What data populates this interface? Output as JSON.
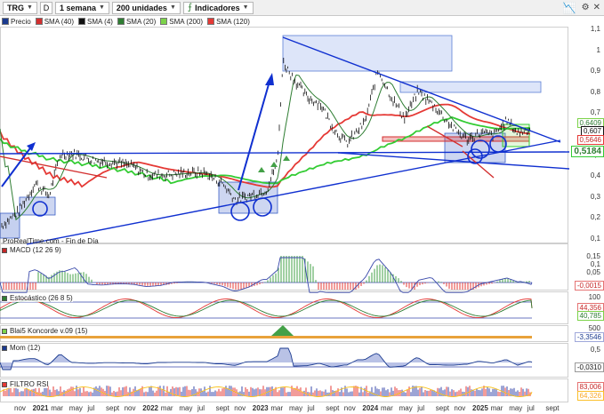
{
  "toolbar": {
    "symbol": "TRG",
    "letter": "D",
    "period": "1 semana",
    "units": "200 unidades",
    "indicators": "Indicadores"
  },
  "legend": [
    {
      "label": "Precio",
      "color": "#1a3a8f"
    },
    {
      "label": "SMA (40)",
      "color": "#d32f2f"
    },
    {
      "label": "SMA (4)",
      "color": "#111111"
    },
    {
      "label": "SMA (20)",
      "color": "#2e7d32"
    },
    {
      "label": "SMA (200)",
      "color": "#7cd34a"
    },
    {
      "label": "SMA (120)",
      "color": "#e53935"
    }
  ],
  "price_axis": [
    "1,1",
    "1",
    "0,9",
    "0,8",
    "0,7",
    "0,6",
    "0,5",
    "0,4",
    "0,3",
    "0,2",
    "0,1"
  ],
  "badges": {
    "a": "0,6409",
    "b": "0,607",
    "c": "0,5646",
    "d": "0,5184"
  },
  "source_label": "ProRealTime.com - Fin de Día",
  "panels": {
    "macd": {
      "title": "MACD (12 26 9)",
      "axis": [
        "0,15",
        "0,1",
        "0,05"
      ],
      "value": "-0,0015"
    },
    "stoch": {
      "title": "Estocástico (26 8 5)",
      "axis": [
        "100"
      ],
      "v1": "44,356",
      "v2": "40,785"
    },
    "blai": {
      "title": "Blai5 Koncorde v.09 (15)",
      "axis": [
        "500",
        "0"
      ],
      "value": "-3,3546"
    },
    "mom": {
      "title": "Mom (12)",
      "axis": [
        "0,5"
      ],
      "value": "-0,0310"
    },
    "rsi": {
      "title": "FILTRO RSI",
      "v1": "83,006",
      "v2": "64,326"
    }
  },
  "x_axis": [
    {
      "t": "nov",
      "yr": false
    },
    {
      "t": "2021",
      "yr": true
    },
    {
      "t": "mar",
      "yr": false
    },
    {
      "t": "may",
      "yr": false
    },
    {
      "t": "jul",
      "yr": false
    },
    {
      "t": "sept",
      "yr": false
    },
    {
      "t": "nov",
      "yr": false
    },
    {
      "t": "2022",
      "yr": true
    },
    {
      "t": "mar",
      "yr": false
    },
    {
      "t": "may",
      "yr": false
    },
    {
      "t": "jul",
      "yr": false
    },
    {
      "t": "sept",
      "yr": false
    },
    {
      "t": "nov",
      "yr": false
    },
    {
      "t": "2023",
      "yr": true
    },
    {
      "t": "mar",
      "yr": false
    },
    {
      "t": "may",
      "yr": false
    },
    {
      "t": "jul",
      "yr": false
    },
    {
      "t": "sept",
      "yr": false
    },
    {
      "t": "nov",
      "yr": false
    },
    {
      "t": "2024",
      "yr": true
    },
    {
      "t": "mar",
      "yr": false
    },
    {
      "t": "may",
      "yr": false
    },
    {
      "t": "jul",
      "yr": false
    },
    {
      "t": "sept",
      "yr": false
    },
    {
      "t": "nov",
      "yr": false
    },
    {
      "t": "2025",
      "yr": true
    },
    {
      "t": "mar",
      "yr": false
    },
    {
      "t": "may",
      "yr": false
    },
    {
      "t": "jul",
      "yr": false
    },
    {
      "t": "sept",
      "yr": false
    }
  ],
  "colors": {
    "price": "#1a3a8f",
    "sma200": "#33cc33",
    "sma120": "#e53935",
    "trend": "#1030d0"
  }
}
